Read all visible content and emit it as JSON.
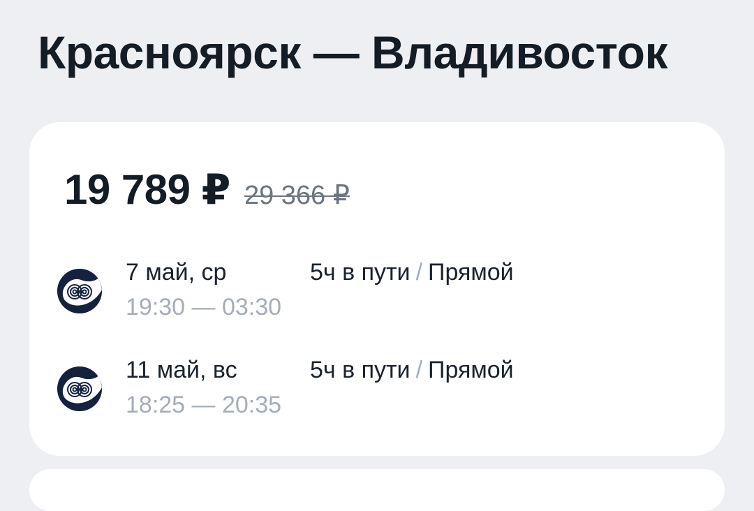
{
  "route": {
    "title": "Красноярск — Владивосток"
  },
  "offer": {
    "price_current": "19 789 ₽",
    "price_old": "29 366 ₽"
  },
  "segments": [
    {
      "date": "7 май, ср",
      "time": "19:30 — 03:30",
      "duration": "5ч в пути",
      "separator": "/",
      "type": "Прямой",
      "airline_icon": "airline-logo-icon"
    },
    {
      "date": "11 май, вс",
      "time": "18:25 — 20:35",
      "duration": "5ч в пути",
      "separator": "/",
      "type": "Прямой",
      "airline_icon": "airline-logo-icon"
    }
  ],
  "colors": {
    "background": "#edeff3",
    "card": "#ffffff",
    "text_primary": "#141c26",
    "text_secondary": "#a5adb7",
    "logo_dark": "#15223f"
  }
}
